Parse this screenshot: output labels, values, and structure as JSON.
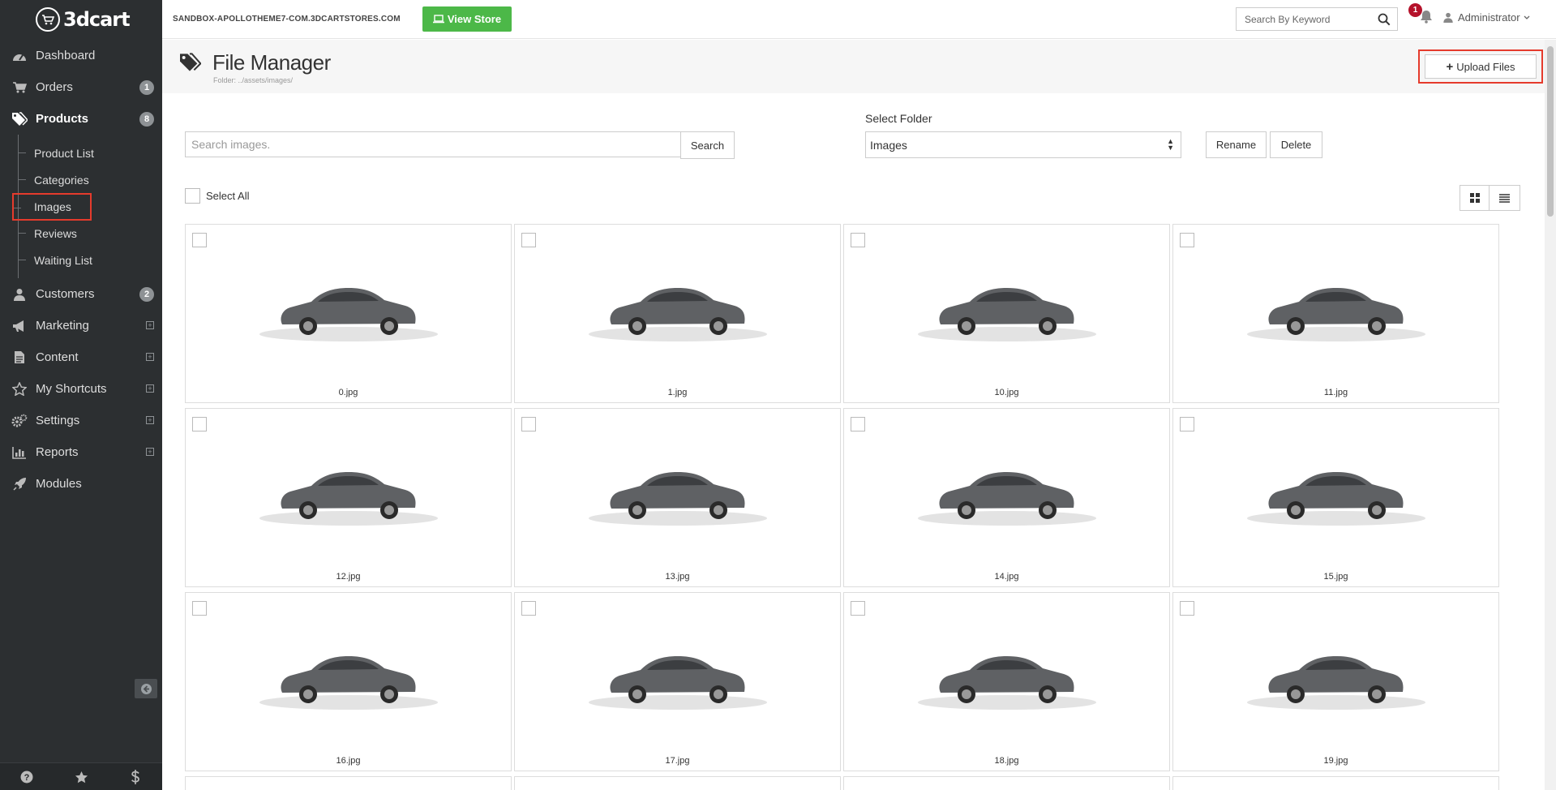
{
  "brand": {
    "name": "3dcart"
  },
  "sidebar": {
    "items": [
      {
        "label": "Dashboard",
        "icon": "dashboard-icon"
      },
      {
        "label": "Orders",
        "icon": "cart-icon",
        "badge": "1"
      },
      {
        "label": "Products",
        "icon": "tags-icon",
        "badge": "8",
        "active": true
      },
      {
        "label": "Customers",
        "icon": "user-icon",
        "badge": "2"
      },
      {
        "label": "Marketing",
        "icon": "bullhorn-icon"
      },
      {
        "label": "Content",
        "icon": "file-icon"
      },
      {
        "label": "My Shortcuts",
        "icon": "star-icon"
      },
      {
        "label": "Settings",
        "icon": "cogs-icon"
      },
      {
        "label": "Reports",
        "icon": "bar-chart-icon"
      },
      {
        "label": "Modules",
        "icon": "rocket-icon"
      }
    ],
    "sub_items": [
      "Product List",
      "Categories",
      "Images",
      "Reviews",
      "Waiting List"
    ],
    "footer": [
      "help-icon",
      "star-icon",
      "dollar-icon"
    ]
  },
  "topbar": {
    "store_url": "SANDBOX-APOLLOTHEME7-COM.3DCARTSTORES.COM",
    "view_store": "View Store",
    "search_placeholder": "Search By Keyword",
    "notification_count": "1",
    "user": "Administrator"
  },
  "header": {
    "title": "File Manager",
    "folder_path": "Folder: ../assets/images/",
    "upload_label": "Upload Files"
  },
  "controls": {
    "search_placeholder": "Search images.",
    "search_button": "Search",
    "select_folder_label": "Select Folder",
    "folder_value": "Images",
    "rename": "Rename",
    "delete": "Delete",
    "select_all": "Select All"
  },
  "files": [
    "0.jpg",
    "1.jpg",
    "10.jpg",
    "11.jpg",
    "12.jpg",
    "13.jpg",
    "14.jpg",
    "15.jpg",
    "16.jpg",
    "17.jpg",
    "18.jpg",
    "19.jpg"
  ],
  "colors": {
    "sidebar": "#2c2f31",
    "view_store": "#4cb848",
    "highlight": "#e53b2c",
    "notif_badge": "#b5122b"
  }
}
